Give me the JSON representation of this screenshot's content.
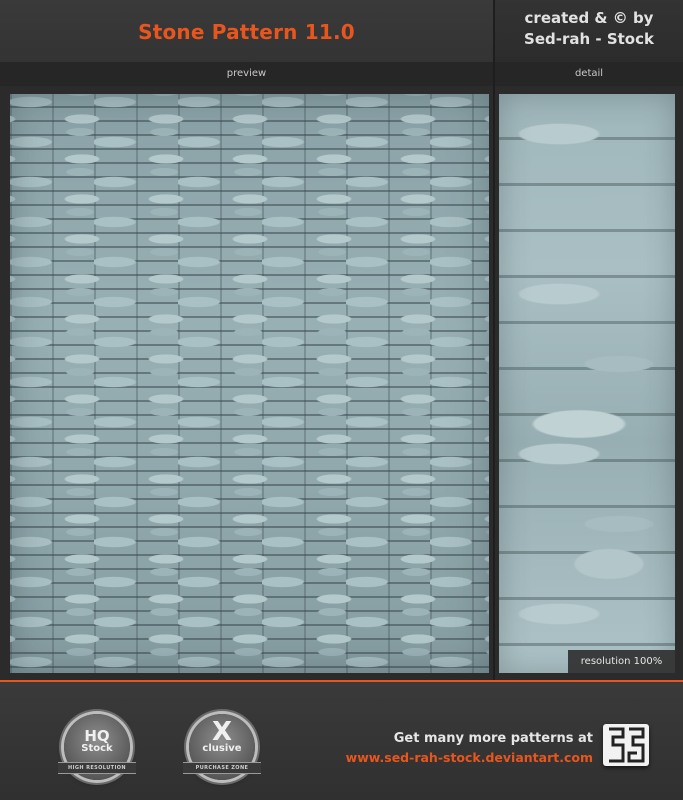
{
  "header": {
    "title": "Stone Pattern 11.0",
    "credit_line1": "created & © by",
    "credit_line2": "Sed-rah - Stock"
  },
  "panels": {
    "preview_label": "preview",
    "detail_label": "detail",
    "resolution_label": "resolution 100%"
  },
  "footer": {
    "badge_hq": {
      "main": "HQ",
      "sub": "Stock",
      "ribbon": "HIGH RESOLUTION"
    },
    "badge_x": {
      "main": "X",
      "sub": "clusive",
      "ribbon": "PURCHASE ZONE"
    },
    "promo_line1": "Get many more patterns at",
    "promo_line2": "www.sed-rah-stock.deviantart.com",
    "logo_icon": "sed-rah-logo-icon"
  },
  "colors": {
    "accent": "#e8561d",
    "background": "#2b2b2b",
    "stone": "#8fa8ad"
  }
}
